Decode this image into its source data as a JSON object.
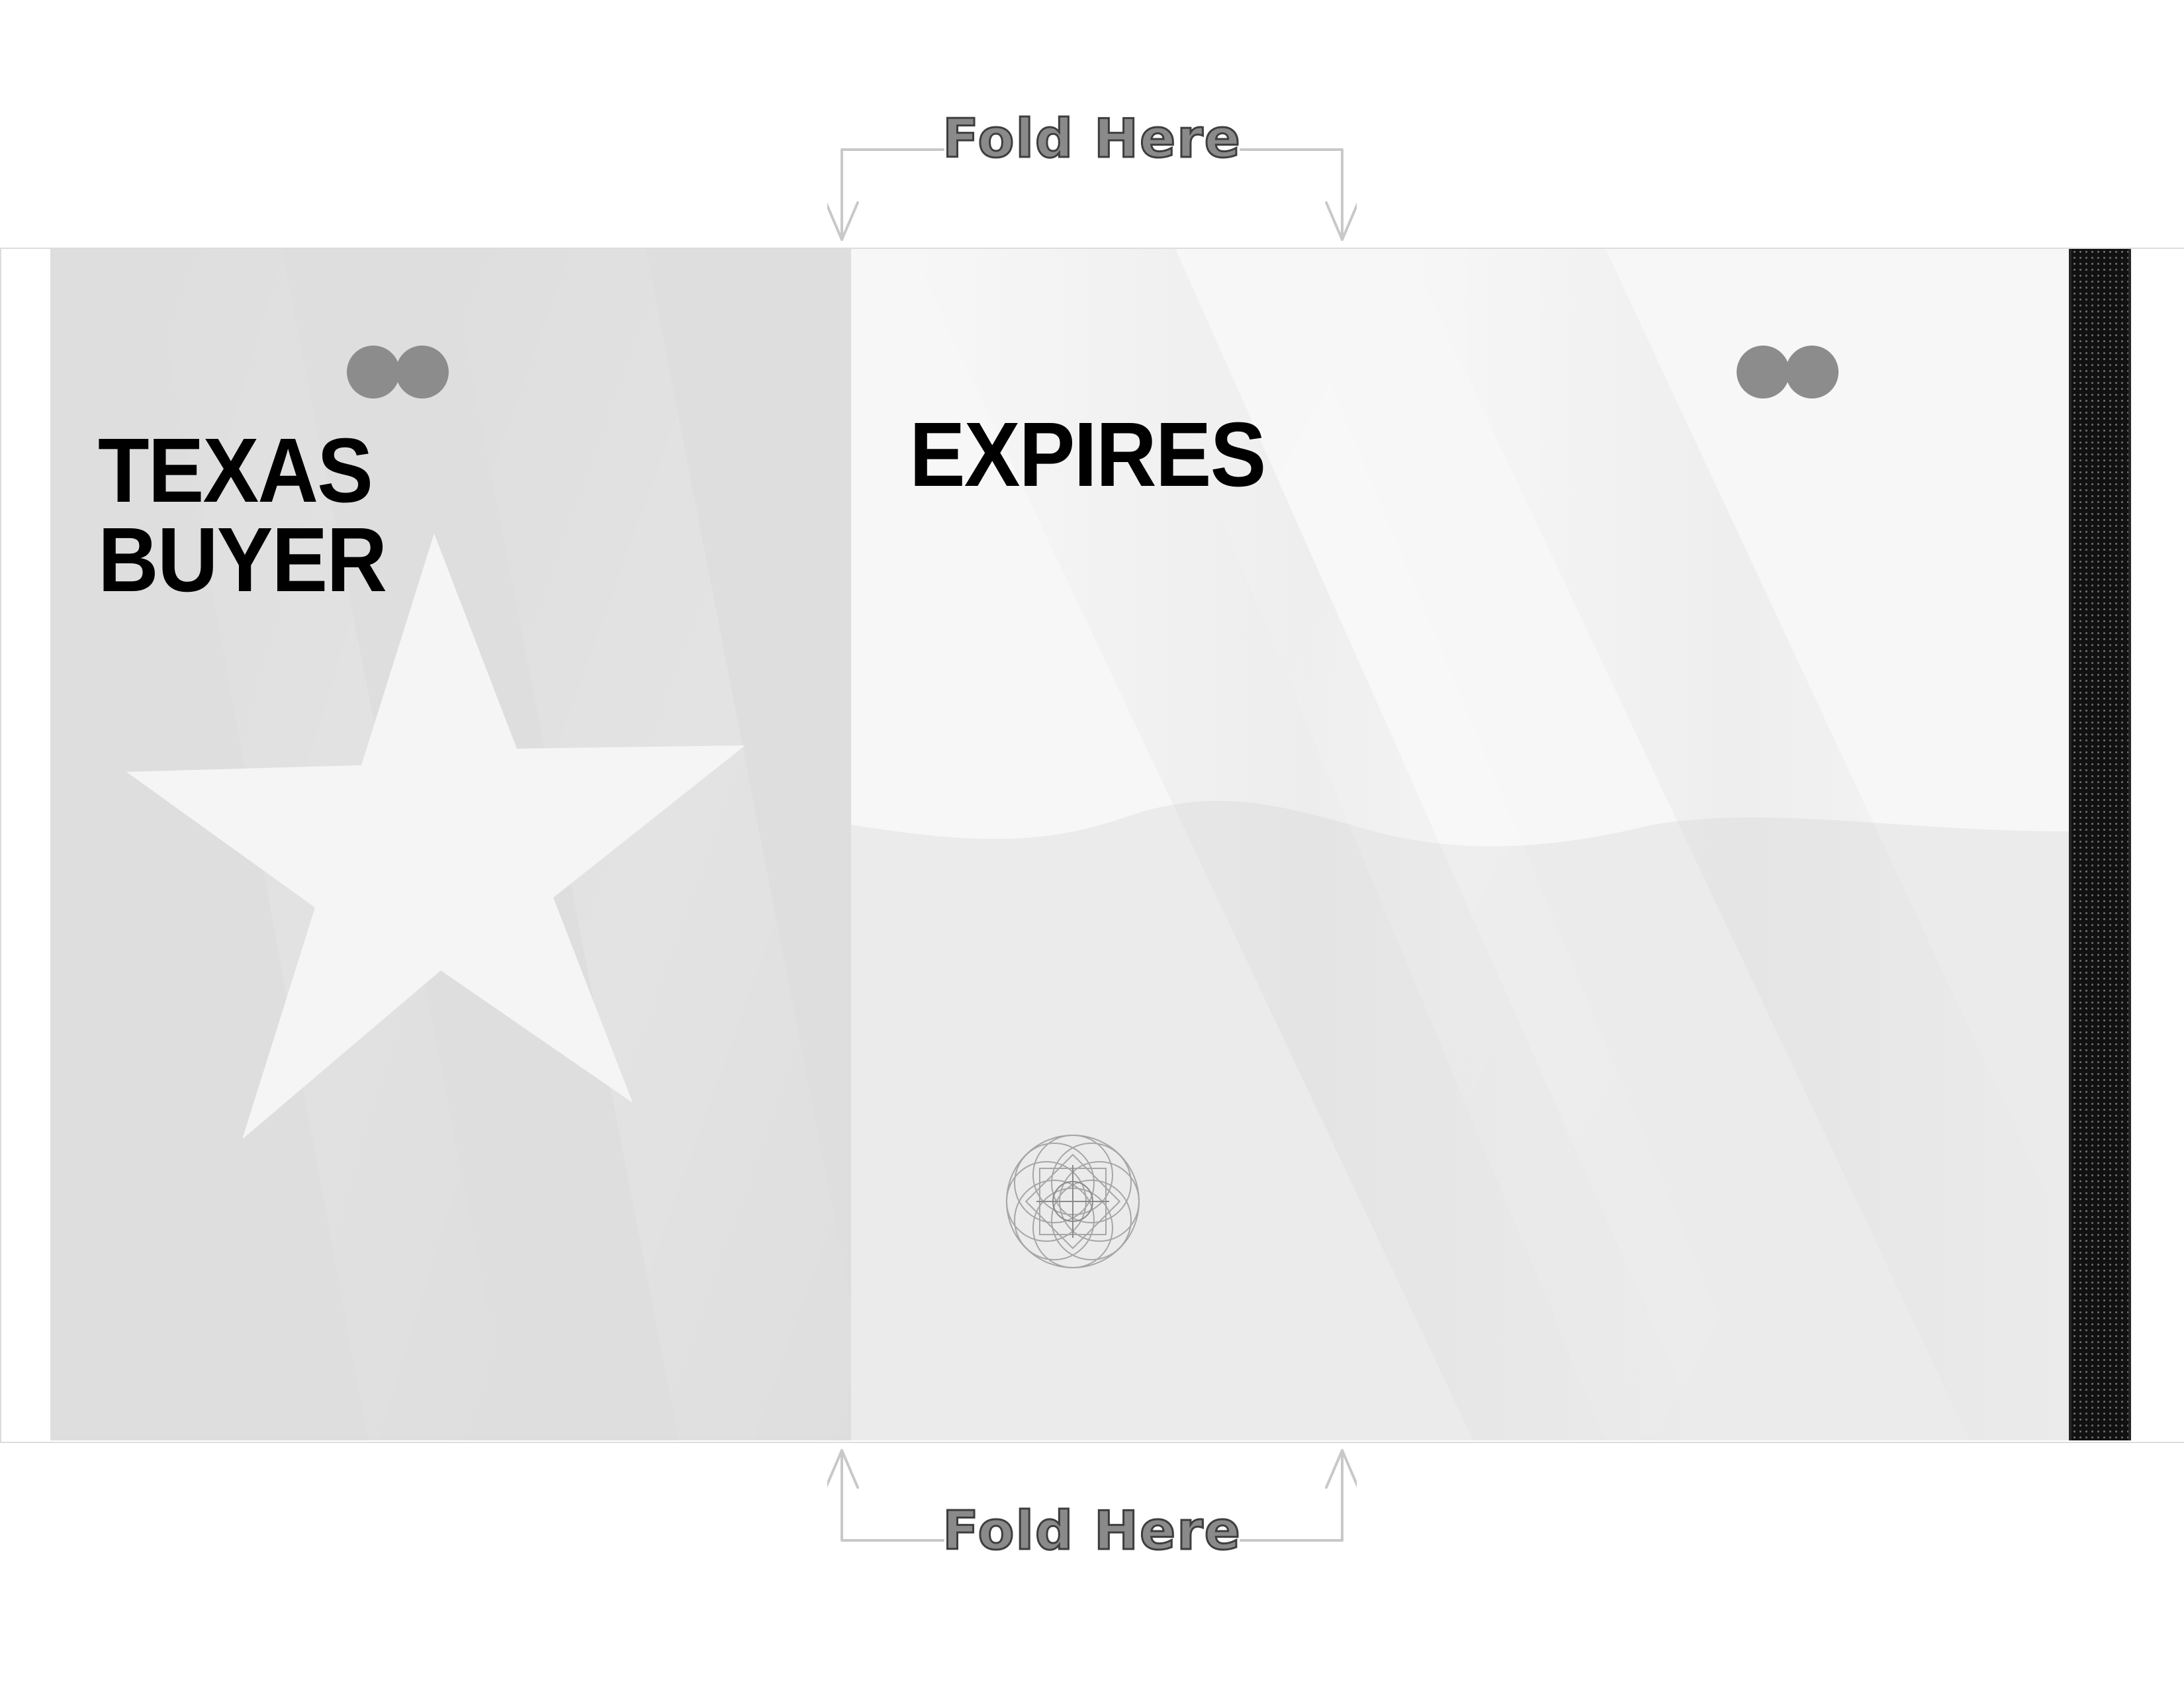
{
  "fold_top": {
    "label": "Fold Here"
  },
  "fold_bottom": {
    "label": "Fold Here"
  },
  "card": {
    "left_title_line1": "TEXAS",
    "left_title_line2": "BUYER",
    "right_title": "EXPIRES",
    "decoration": {
      "flag": "texas-flag",
      "star_icon": "star-icon",
      "seal_icon": "hologram-seal-icon",
      "marker_icon": "double-dot-icon",
      "stripe": "magnetic-stripe"
    }
  },
  "colors": {
    "text": "#000000",
    "fold_label": "#8a8a8a",
    "fold_line": "#c8c8c8",
    "dots": "#8c8c8c",
    "stripe": "#111111",
    "flag_canton": "#dddddd",
    "flag_white": "#f6f6f6",
    "flag_lower": "#ebebeb"
  }
}
